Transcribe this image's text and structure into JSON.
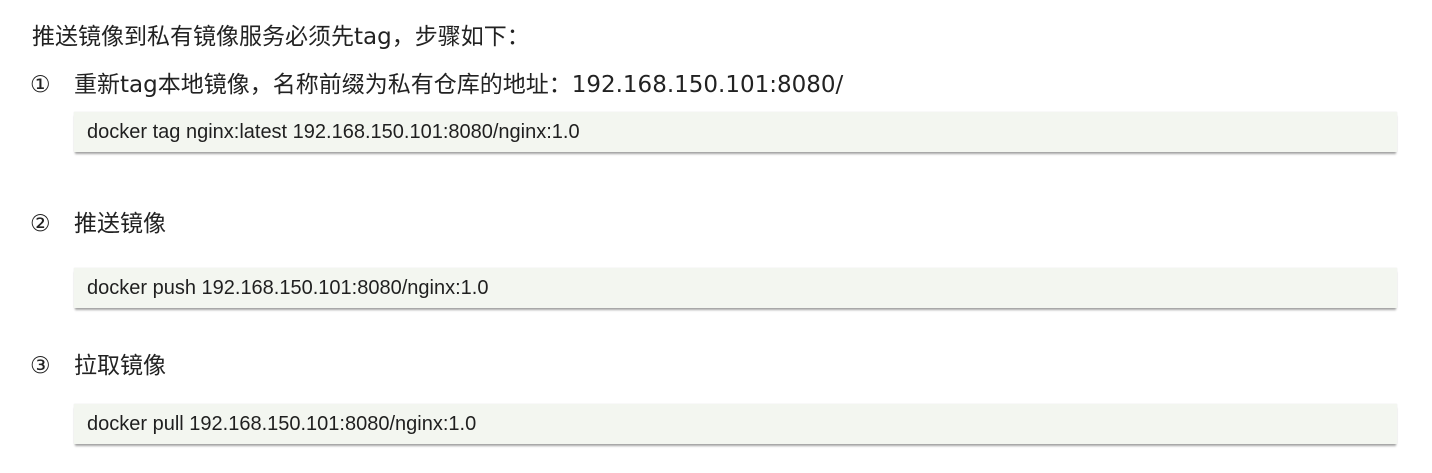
{
  "intro": "推送镜像到私有镜像服务必须先tag，步骤如下：",
  "steps": [
    {
      "marker": "①",
      "title": "重新tag本地镜像，名称前缀为私有仓库的地址：192.168.150.101:8080/",
      "code": "docker tag nginx:latest 192.168.150.101:8080/nginx:1.0"
    },
    {
      "marker": "②",
      "title": "推送镜像",
      "code": "docker push 192.168.150.101:8080/nginx:1.0"
    },
    {
      "marker": "③",
      "title": "拉取镜像",
      "code": "docker pull 192.168.150.101:8080/nginx:1.0"
    }
  ]
}
